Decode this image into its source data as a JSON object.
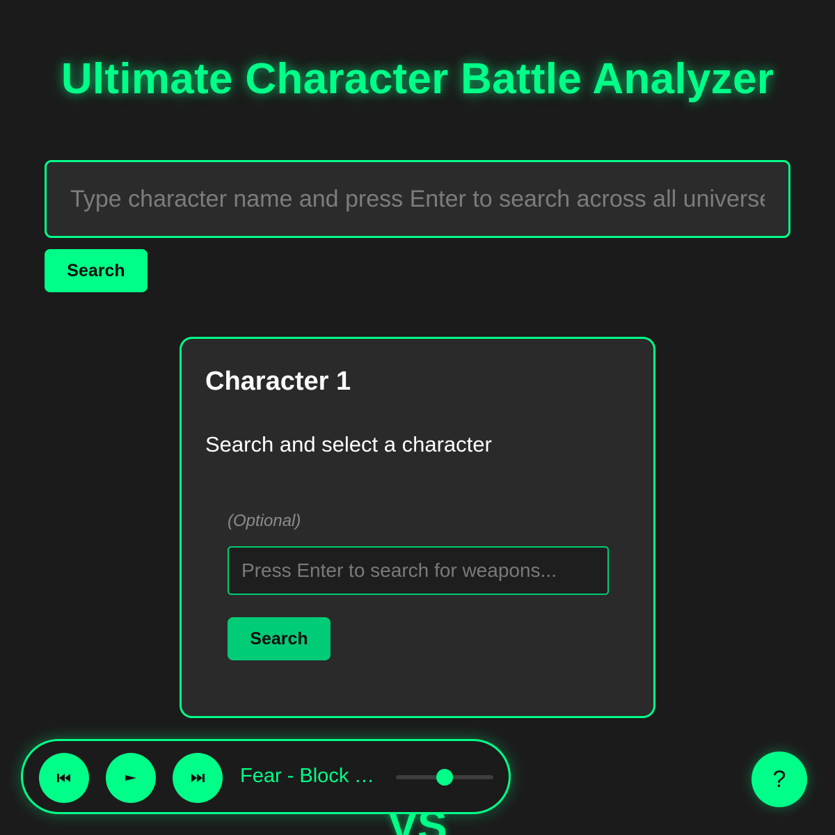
{
  "header": {
    "title": "Ultimate Character Battle Analyzer"
  },
  "search": {
    "placeholder": "Type character name and press Enter to search across all universes...",
    "button_label": "Search"
  },
  "character_card": {
    "title": "Character 1",
    "subtitle": "Search and select a character",
    "weapon": {
      "optional_label": "(Optional)",
      "placeholder": "Press Enter to search for weapons...",
      "button_label": "Search"
    }
  },
  "versus_label": "VS",
  "music_player": {
    "prev_icon": "skip-back-icon",
    "play_icon": "play-icon",
    "next_icon": "skip-forward-icon",
    "track_title": "Fear - Block T...",
    "volume": 0.5
  },
  "help_button": {
    "label": "?"
  },
  "colors": {
    "accent": "#00ff88",
    "background": "#1b1b1b",
    "panel": "#2a2a2a"
  }
}
